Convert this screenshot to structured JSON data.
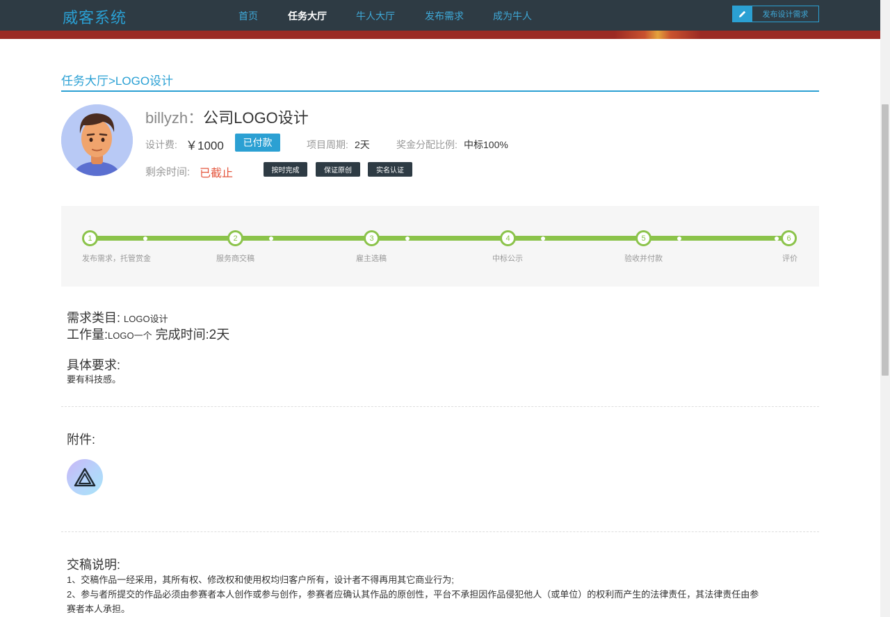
{
  "nav": {
    "brand": "威客系统",
    "items": [
      {
        "label": "首页"
      },
      {
        "label": "任务大厅"
      },
      {
        "label": "牛人大厅"
      },
      {
        "label": "发布需求"
      },
      {
        "label": "成为牛人"
      }
    ],
    "active_index": 1,
    "publish_button": "发布设计需求"
  },
  "breadcrumb": "任务大厅>LOGO设计",
  "task": {
    "username": "billyzh：",
    "title": "公司LOGO设计",
    "fee_label": "设计费:",
    "fee_value": "￥1000",
    "paid_button": "已付款",
    "period_label": "项目周期:",
    "period_value": "2天",
    "ratio_label": "奖金分配比例:",
    "ratio_value": "中标100%",
    "remain_label": "剩余时间:",
    "remain_value": "已截止",
    "tags": [
      "按时完成",
      "保证原创",
      "实名认证"
    ]
  },
  "progress": {
    "steps": [
      {
        "num": "1",
        "label": "发布需求，托管赏金"
      },
      {
        "num": "2",
        "label": "服务商交稿"
      },
      {
        "num": "3",
        "label": "雇主选稿"
      },
      {
        "num": "4",
        "label": "中标公示"
      },
      {
        "num": "5",
        "label": "验收并付款"
      },
      {
        "num": "6",
        "label": "评价"
      }
    ]
  },
  "requirements": {
    "category_label": "需求类目:",
    "category_value": "LOGO设计",
    "workload_label": "工作量:",
    "workload_value": "LOGO一个",
    "finish_label": "完成时间:",
    "finish_value": "2天",
    "detail_title": "具体要求:",
    "detail_text": "要有科技感。"
  },
  "attachments": {
    "title": "附件:"
  },
  "submission": {
    "title": "交稿说明:",
    "line1": "1、交稿作品一经采用，其所有权、修改权和使用权均归客户所有，设计者不得再用其它商业行为;",
    "line2": "2、参与者所提交的作品必须由参赛者本人创作或参与创作，参赛者应确认其作品的原创性，平台不承担因作品侵犯他人（或单位）的权利而产生的法律责任，其法律责任由参",
    "line3": "赛者本人承担。"
  },
  "colors": {
    "navbar": "#2e3b44",
    "accent": "#2ba0d3",
    "progress": "#8bc34a",
    "deadline": "#e4563d"
  }
}
